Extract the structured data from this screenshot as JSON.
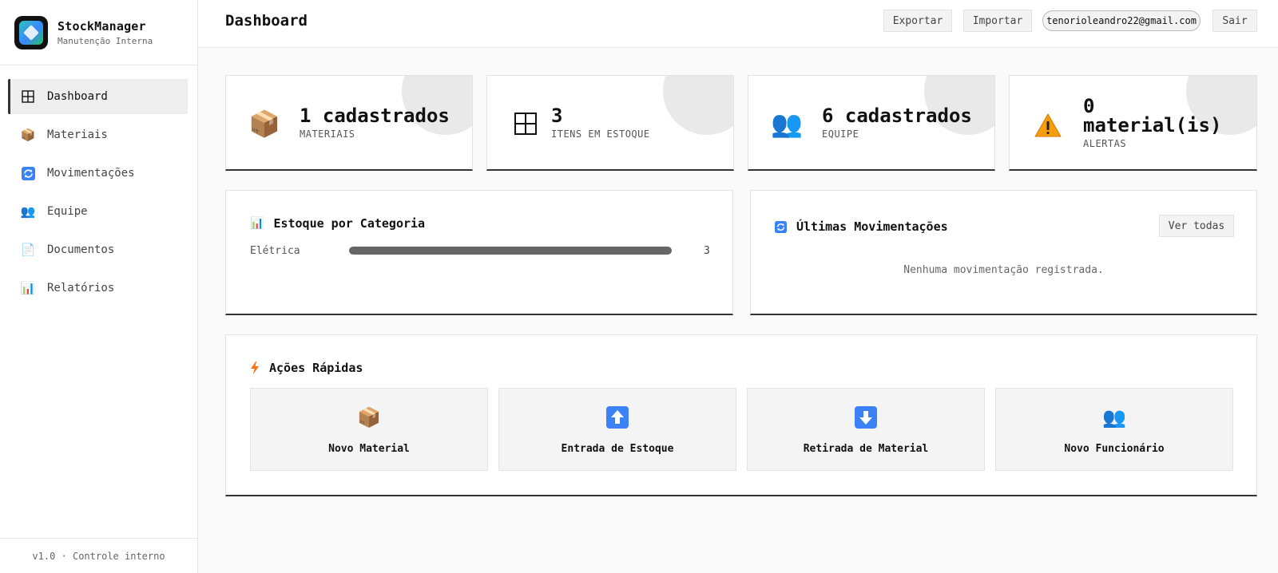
{
  "brand": {
    "title": "StockManager",
    "subtitle": "Manutenção Interna"
  },
  "sidebar": {
    "items": [
      {
        "label": "Dashboard",
        "icon": "grid-icon",
        "active": true
      },
      {
        "label": "Materiais",
        "icon": "box-icon"
      },
      {
        "label": "Movimentações",
        "icon": "refresh-icon"
      },
      {
        "label": "Equipe",
        "icon": "people-icon"
      },
      {
        "label": "Documentos",
        "icon": "document-icon"
      },
      {
        "label": "Relatórios",
        "icon": "chart-icon"
      }
    ],
    "footer": "v1.0 · Controle interno"
  },
  "header": {
    "title": "Dashboard",
    "export_label": "Exportar",
    "import_label": "Importar",
    "user_email": "tenorioleandro22@gmail.com",
    "logout_label": "Sair"
  },
  "stats": [
    {
      "value": "1 cadastrados",
      "label": "MATERIAIS",
      "icon": "box-icon"
    },
    {
      "value": "3",
      "label": "ITENS EM ESTOQUE",
      "icon": "grid-icon"
    },
    {
      "value": "6 cadastrados",
      "label": "EQUIPE",
      "icon": "people-icon"
    },
    {
      "value_line1": "0",
      "value_line2": "material(is)",
      "label": "ALERTAS",
      "icon": "warning-icon"
    }
  ],
  "stock_by_category": {
    "title": "Estoque por Categoria",
    "icon": "chart-icon",
    "rows": [
      {
        "category": "Elétrica",
        "count": "3",
        "fraction": 1.0
      }
    ]
  },
  "recent_movements": {
    "title": "Últimas Movimentações",
    "icon": "refresh-icon",
    "see_all_label": "Ver todas",
    "empty_text": "Nenhuma movimentação registrada."
  },
  "quick_actions": {
    "title": "Ações Rápidas",
    "icon": "lightning-icon",
    "items": [
      {
        "label": "Novo Material",
        "icon": "box-icon"
      },
      {
        "label": "Entrada de Estoque",
        "icon": "arrow-up-icon"
      },
      {
        "label": "Retirada de Material",
        "icon": "arrow-down-icon"
      },
      {
        "label": "Novo Funcionário",
        "icon": "people-icon"
      }
    ]
  },
  "colors": {
    "accent": "#333333",
    "bar": "#666666",
    "arrow_blue": "#3b82f6",
    "warning": "#f59e0b"
  }
}
